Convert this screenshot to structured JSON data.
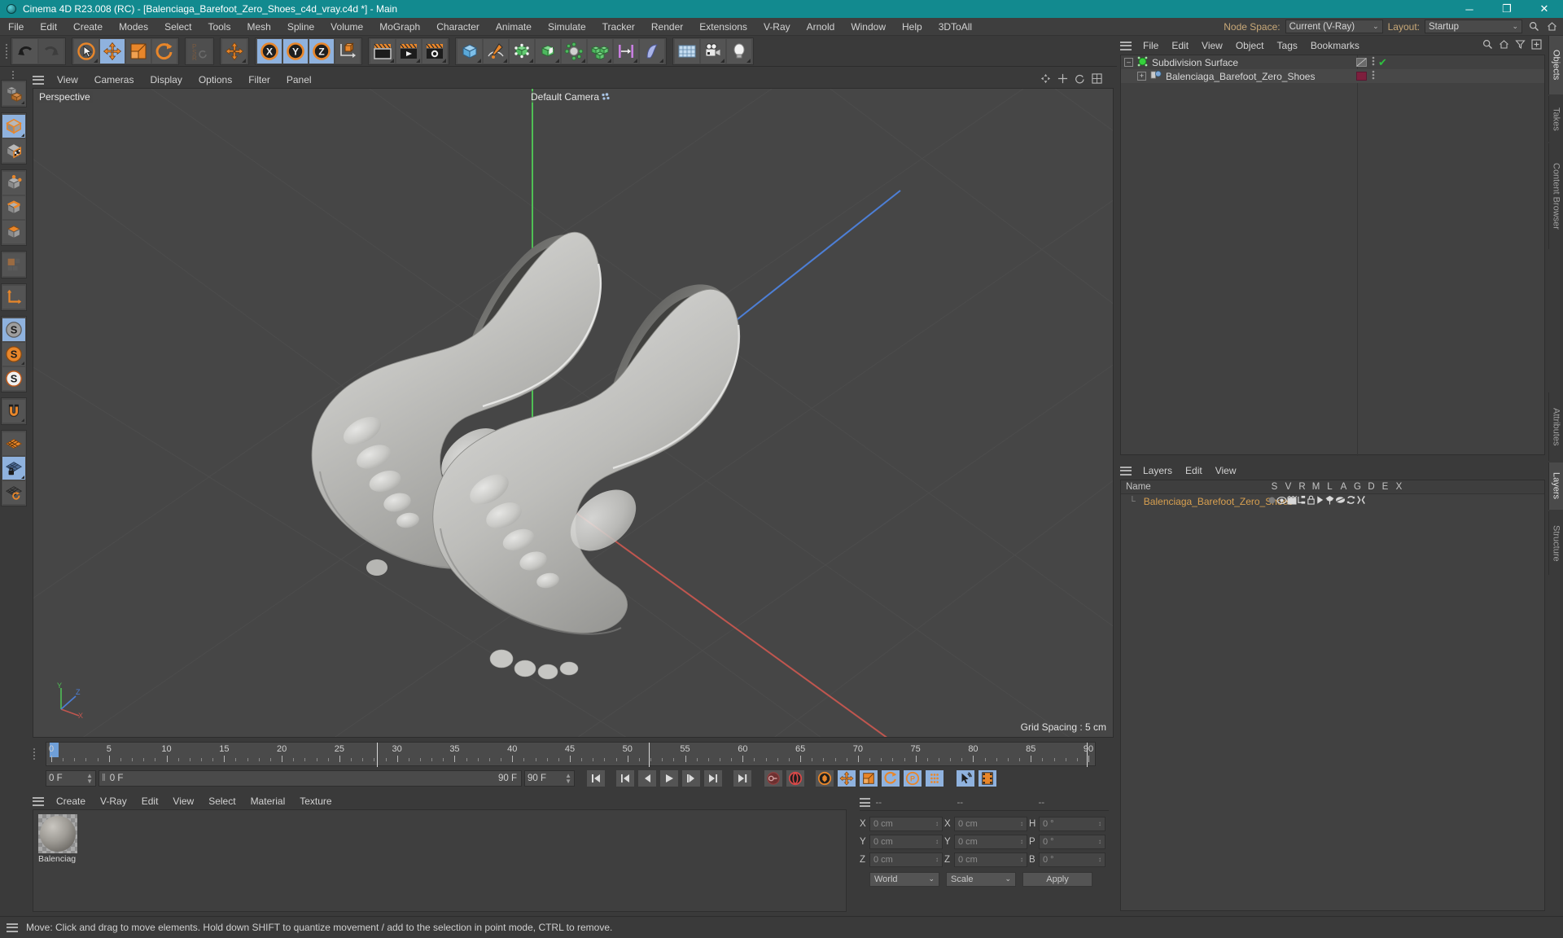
{
  "window": {
    "title": "Cinema 4D R23.008 (RC) - [Balenciaga_Barefoot_Zero_Shoes_c4d_vray.c4d *] - Main",
    "minimize": "─",
    "maximize": "❐",
    "close": "✕"
  },
  "menubar": {
    "items": [
      "File",
      "Edit",
      "Create",
      "Modes",
      "Select",
      "Tools",
      "Mesh",
      "Spline",
      "Volume",
      "MoGraph",
      "Character",
      "Animate",
      "Simulate",
      "Tracker",
      "Render",
      "Extensions",
      "V-Ray",
      "Arnold",
      "Window",
      "Help",
      "3DToAll"
    ],
    "node_space_label": "Node Space:",
    "node_space_value": "Current (V-Ray)",
    "layout_label": "Layout:",
    "layout_value": "Startup",
    "chevron": "⌄"
  },
  "toolbar": {
    "groups": [
      {
        "name": "history",
        "buttons": [
          {
            "name": "undo-button",
            "icon": "undo-icon",
            "state": "off"
          },
          {
            "name": "redo-button",
            "icon": "redo-icon",
            "state": "disabled"
          }
        ]
      },
      {
        "name": "transform-tools",
        "buttons": [
          {
            "name": "live-selection-tool",
            "icon": "cursor-circle-icon",
            "state": "off"
          },
          {
            "name": "move-tool",
            "icon": "move-arrows-icon",
            "state": "on"
          },
          {
            "name": "scale-tool",
            "icon": "scale-box-icon",
            "state": "off"
          },
          {
            "name": "rotate-tool",
            "icon": "rotate-arrows-icon",
            "state": "off"
          }
        ]
      },
      {
        "name": "psr-lock",
        "buttons": [
          {
            "name": "psr-lock-button",
            "icon": "psr-icon",
            "state": "disabled"
          }
        ]
      },
      {
        "name": "world-object-axis",
        "buttons": [
          {
            "name": "world-object-axis-button",
            "icon": "move-arrows-icon",
            "state": "off"
          }
        ]
      },
      {
        "name": "axis-locks",
        "buttons": [
          {
            "name": "lock-x-axis-button",
            "icon": "x-axis-icon",
            "state": "on",
            "label": "X"
          },
          {
            "name": "lock-y-axis-button",
            "icon": "y-axis-icon",
            "state": "on",
            "label": "Y"
          },
          {
            "name": "lock-z-axis-button",
            "icon": "z-axis-icon",
            "state": "on",
            "label": "Z"
          },
          {
            "name": "object-world-coord-button",
            "icon": "coord-system-icon",
            "state": "off"
          }
        ]
      },
      {
        "name": "render-group",
        "buttons": [
          {
            "name": "render-view-button",
            "icon": "render-view-icon",
            "state": "off"
          },
          {
            "name": "render-to-picture-viewer-button",
            "icon": "render-picture-icon",
            "state": "off"
          },
          {
            "name": "render-settings-button",
            "icon": "render-settings-icon",
            "state": "off"
          }
        ]
      },
      {
        "name": "create-group",
        "buttons": [
          {
            "name": "add-cube-button",
            "icon": "cube-icon",
            "state": "off"
          },
          {
            "name": "add-spline-button",
            "icon": "pen-spline-icon",
            "state": "off"
          },
          {
            "name": "add-generator-button",
            "icon": "generator-icon",
            "state": "off"
          },
          {
            "name": "add-deformer-button",
            "icon": "deformer-icon",
            "state": "off"
          },
          {
            "name": "add-environment-button",
            "icon": "environment-icon",
            "state": "off"
          },
          {
            "name": "add-mograph-button",
            "icon": "mograph-cubes-icon",
            "state": "off"
          },
          {
            "name": "add-measure-button",
            "icon": "measure-icon",
            "state": "off"
          },
          {
            "name": "add-field-button",
            "icon": "field-icon",
            "state": "off"
          }
        ]
      },
      {
        "name": "scene-group",
        "buttons": [
          {
            "name": "add-floor-button",
            "icon": "floor-grid-icon",
            "state": "off"
          },
          {
            "name": "add-camera-button",
            "icon": "camera-icon",
            "state": "off"
          },
          {
            "name": "add-light-button",
            "icon": "light-bulb-icon",
            "state": "off"
          }
        ]
      }
    ]
  },
  "left_toolbar": {
    "buttons": [
      {
        "name": "make-editable-button",
        "icon": "make-editable-icon"
      },
      {
        "name": "model-mode-button",
        "icon": "model-cube-icon",
        "state": "on"
      },
      {
        "name": "texture-mode-button",
        "icon": "texture-checker-icon"
      },
      {
        "name": "points-mode-button",
        "icon": "points-icon"
      },
      {
        "name": "edges-mode-button",
        "icon": "edges-icon"
      },
      {
        "name": "polygons-mode-button",
        "icon": "polygons-icon"
      },
      {
        "name": "uv-mode-button",
        "icon": "uv-tiles-icon"
      },
      {
        "name": "axis-mode-button",
        "icon": "axis-corner-icon"
      },
      {
        "name": "enable-snap-button",
        "icon": "snap-s-gray-icon",
        "state": "on"
      },
      {
        "name": "quantize-button",
        "icon": "snap-s-orange-icon"
      },
      {
        "name": "workplane-snap-button",
        "icon": "snap-s-white-icon"
      },
      {
        "name": "magnet-button",
        "icon": "magnet-icon"
      },
      {
        "name": "workplane-button",
        "icon": "workplane-orange-icon"
      },
      {
        "name": "lock-workplane-button",
        "icon": "workplane-lock-icon",
        "state": "on"
      },
      {
        "name": "planar-workplane-button",
        "icon": "workplane-rotate-icon"
      }
    ]
  },
  "viewport": {
    "menu": [
      "View",
      "Cameras",
      "Display",
      "Options",
      "Filter",
      "Panel"
    ],
    "label": "Perspective",
    "camera_label": "Default Camera",
    "grid_spacing": "Grid Spacing : 5 cm",
    "axis": {
      "x": "X",
      "y": "Y",
      "z": "Z"
    }
  },
  "timeline": {
    "ticks": [
      "0",
      "5",
      "10",
      "15",
      "20",
      "25",
      "30",
      "35",
      "40",
      "45",
      "50",
      "55",
      "60",
      "65",
      "70",
      "75",
      "80",
      "85",
      "90"
    ],
    "current_frame": "0 F",
    "preview_min": "0 F",
    "preview_max": "90 F",
    "frame_end": "90 F",
    "frame_field_right": "0 F",
    "transport": [
      {
        "name": "go-to-start-button",
        "icon": "skip-start-icon"
      },
      {
        "name": "previous-key-button",
        "icon": "prev-key-icon"
      },
      {
        "name": "previous-frame-button",
        "icon": "prev-frame-icon"
      },
      {
        "name": "play-button",
        "icon": "play-icon"
      },
      {
        "name": "next-frame-button",
        "icon": "next-frame-icon"
      },
      {
        "name": "next-key-button",
        "icon": "next-key-icon"
      },
      {
        "name": "go-to-end-button",
        "icon": "skip-end-icon"
      },
      {
        "name": "record-active-objects-button",
        "icon": "record-key-icon"
      },
      {
        "name": "autokeying-button",
        "icon": "autokey-icon"
      },
      {
        "name": "keyframe-selection-button",
        "icon": "keyframe-select-icon"
      },
      {
        "name": "position-key-button",
        "icon": "position-key-icon",
        "state": "on"
      },
      {
        "name": "scale-key-button",
        "icon": "scale-key-icon",
        "state": "on"
      },
      {
        "name": "rotation-key-button",
        "icon": "rotation-key-icon",
        "state": "on"
      },
      {
        "name": "parameter-key-button",
        "icon": "parameter-key-icon",
        "state": "on"
      },
      {
        "name": "point-level-animation-button",
        "icon": "pla-dots-icon"
      },
      {
        "name": "link-to-object-manager-button",
        "icon": "link-selection-icon",
        "state": "on"
      },
      {
        "name": "timeline-button",
        "icon": "filmstrip-icon",
        "state": "on"
      }
    ]
  },
  "material_manager": {
    "menu": [
      "Create",
      "V-Ray",
      "Edit",
      "View",
      "Select",
      "Material",
      "Texture"
    ],
    "materials": [
      {
        "name": "Balenciag"
      }
    ]
  },
  "coordinate_manager": {
    "header": [
      "--",
      "--",
      "--"
    ],
    "rows": [
      {
        "label1": "X",
        "value1": "0 cm",
        "label2": "X",
        "value2": "0 cm",
        "label3": "H",
        "value3": "0 °"
      },
      {
        "label1": "Y",
        "value1": "0 cm",
        "label2": "Y",
        "value2": "0 cm",
        "label3": "P",
        "value3": "0 °"
      },
      {
        "label1": "Z",
        "value1": "0 cm",
        "label2": "Z",
        "value2": "0 cm",
        "label3": "B",
        "value3": "0 °"
      }
    ],
    "space_select": "World",
    "mode_select": "Scale",
    "apply_button": "Apply",
    "chevron": "⌄"
  },
  "object_manager": {
    "menu": [
      "File",
      "Edit",
      "View",
      "Object",
      "Tags",
      "Bookmarks"
    ],
    "objects": [
      {
        "name": "Subdivision Surface",
        "indent": 0,
        "icon": "subdivision-surface-icon",
        "color": "#30d23a",
        "tag_color": "#6a6a6a",
        "check": "✔"
      },
      {
        "name": "Balenciaga_Barefoot_Zero_Shoes",
        "indent": 1,
        "icon": "polygon-object-icon",
        "color": "#7fa8d8",
        "tag_color": "#7d1f3d",
        "check": ""
      }
    ]
  },
  "layer_manager": {
    "menu": [
      "Layers",
      "Edit",
      "View"
    ],
    "columns": [
      "Name",
      "S",
      "V",
      "R",
      "M",
      "L",
      "A",
      "G",
      "D",
      "E",
      "X"
    ],
    "rows": [
      {
        "name": "Balenciaga_Barefoot_Zero_Shoes",
        "color": "#7d1f3d"
      }
    ]
  },
  "right_tabs": {
    "top": [
      "Objects",
      "Takes",
      "Content Browser"
    ],
    "bottom": [
      "Attributes",
      "Layers",
      "Structure"
    ],
    "active_top": "Objects",
    "active_bottom": "Layers"
  },
  "statusbar": {
    "message": "Move: Click and drag to move elements. Hold down SHIFT to quantize movement / add to the selection in point mode, CTRL to remove."
  },
  "colors": {
    "title_bg": "#128a8f",
    "panel_bg": "#3a3a3a",
    "viewport_bg": "#464646",
    "accent_orange": "#e8862a",
    "accent_blue": "#8fb2de",
    "axis_x": "#c84b4b",
    "axis_y": "#4bbd4b",
    "axis_z": "#4b7fd8"
  }
}
